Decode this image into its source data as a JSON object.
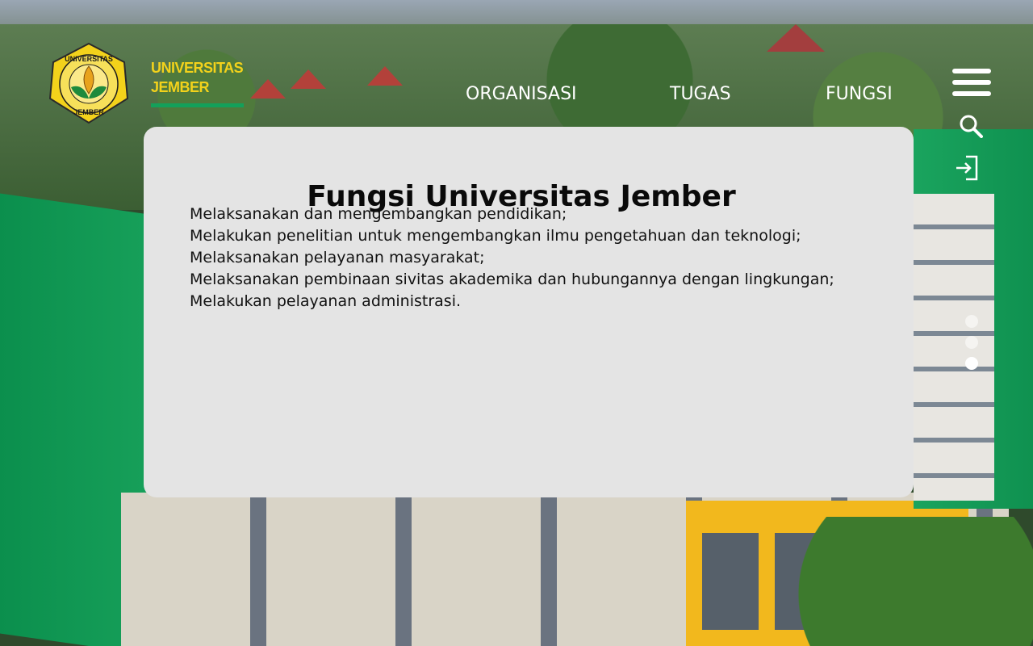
{
  "brand": {
    "name_line1": "UNIVERSITAS",
    "name_line2": "JEMBER",
    "logo_ring_text": "UNIVERSITAS JEMBER",
    "logo_ring_top": "UNIVERSITAS",
    "logo_ring_bottom": "JEMBER",
    "accent_yellow": "#f3d21b",
    "accent_green": "#14a05a"
  },
  "nav": {
    "items": [
      {
        "label": "ORGANISASI"
      },
      {
        "label": "TUGAS"
      },
      {
        "label": "FUNGSI"
      }
    ]
  },
  "header_icons": {
    "menu": "hamburger-menu-icon",
    "search": "search-icon",
    "login": "login-icon"
  },
  "panel": {
    "title": "Fungsi Universitas Jember",
    "items": [
      "Melaksanakan dan mengembangkan pendidikan;",
      "Melakukan penelitian untuk mengembangkan ilmu pengetahuan dan teknologi;",
      "Melaksanakan pelayanan masyarakat;",
      "Melaksanakan pembinaan sivitas akademika dan hubungannya dengan lingkungan;",
      "Melakukan pelayanan administrasi."
    ],
    "background": "#e4e4e4"
  },
  "pager": {
    "total": 3,
    "active_index": 2
  }
}
